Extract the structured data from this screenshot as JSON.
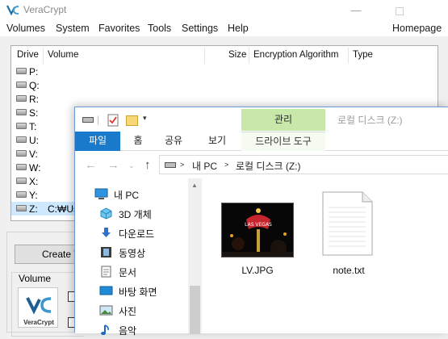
{
  "veracrypt": {
    "title": "VeraCrypt",
    "menu": [
      "Volumes",
      "System",
      "Favorites",
      "Tools",
      "Settings",
      "Help"
    ],
    "homepage": "Homepage",
    "columns": [
      "Drive",
      "Volume",
      "Size",
      "Encryption Algorithm",
      "Type"
    ],
    "drives": [
      {
        "letter": "P:",
        "volume": ""
      },
      {
        "letter": "Q:",
        "volume": ""
      },
      {
        "letter": "R:",
        "volume": ""
      },
      {
        "letter": "S:",
        "volume": ""
      },
      {
        "letter": "T:",
        "volume": ""
      },
      {
        "letter": "U:",
        "volume": ""
      },
      {
        "letter": "V:",
        "volume": ""
      },
      {
        "letter": "W:",
        "volume": ""
      },
      {
        "letter": "X:",
        "volume": ""
      },
      {
        "letter": "Y:",
        "volume": ""
      },
      {
        "letter": "Z:",
        "volume": "C:₩Us"
      }
    ],
    "create_button": "Create V",
    "volume_group": "Volume",
    "logo_text": "VeraCrypt"
  },
  "explorer": {
    "manage_tab": "관리",
    "title": "로컬 디스크 (Z:)",
    "tabs": {
      "file": "파일",
      "home": "홈",
      "share": "공유",
      "view": "보기",
      "drive_tools": "드라이브 도구"
    },
    "address": {
      "pc": "내 PC",
      "drive": "로컬 디스크 (Z:)"
    },
    "nav_items": [
      {
        "label": "내 PC",
        "icon": "pc-icon"
      },
      {
        "label": "3D 개체",
        "icon": "cube-icon"
      },
      {
        "label": "다운로드",
        "icon": "download-icon"
      },
      {
        "label": "동영상",
        "icon": "video-icon"
      },
      {
        "label": "문서",
        "icon": "document-icon"
      },
      {
        "label": "바탕 화면",
        "icon": "desktop-icon"
      },
      {
        "label": "사진",
        "icon": "picture-icon"
      },
      {
        "label": "음악",
        "icon": "music-icon"
      }
    ],
    "files": [
      {
        "name": "LV.JPG",
        "thumb_text": "LAS VEGAS"
      },
      {
        "name": "note.txt"
      }
    ]
  },
  "colors": {
    "file_tab": "#1979ca",
    "manage_tab": "#c7e8a8",
    "selection": "#cde8ff"
  }
}
